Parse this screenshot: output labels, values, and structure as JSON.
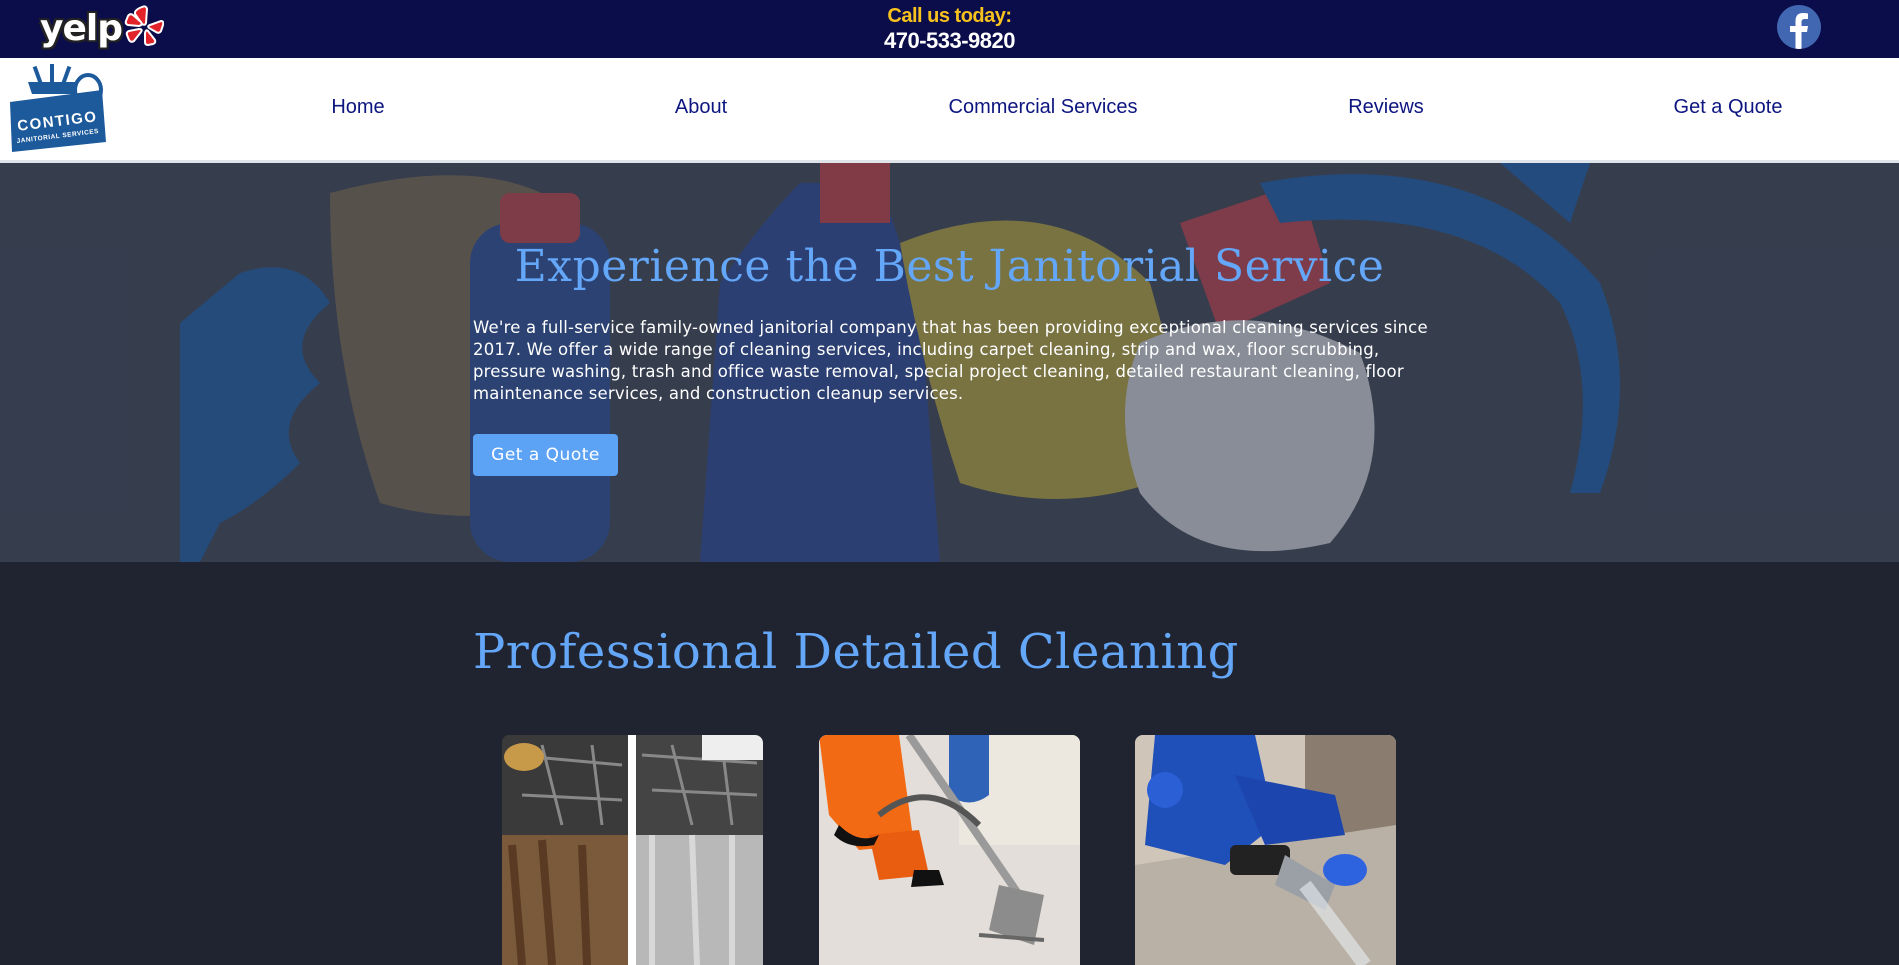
{
  "topbar": {
    "yelp_logo_text": "yelp",
    "call_label": "Call us today:",
    "phone": "470-533-9820",
    "colors": {
      "background": "#0b0c4a",
      "call_label": "#f7c21e"
    }
  },
  "brand": {
    "logo_lines": [
      "CONTIGO",
      "JANITORIAL SERVICES"
    ]
  },
  "nav": {
    "items": [
      "Home",
      "About",
      "Commercial Services",
      "Reviews",
      "Get a Quote"
    ]
  },
  "hero": {
    "title": "Experience the Best Janitorial Service",
    "text": "We're a full-service family-owned janitorial company that has been providing exceptional cleaning services since 2017. We offer a wide range of cleaning services, including carpet cleaning, strip and wax, floor scrubbing, pressure washing, trash and office waste removal, special project cleaning, detailed restaurant cleaning, floor maintenance services, and construction cleanup services.",
    "cta_label": "Get a Quote",
    "colors": {
      "accent": "#64a6f7",
      "button": "#5da3f5"
    }
  },
  "section": {
    "title": "Professional Detailed Cleaning",
    "cards": [
      "kitchen-cleaning-photo",
      "carpet-vacuum-photo",
      "upholstery-cleaning-photo"
    ]
  }
}
